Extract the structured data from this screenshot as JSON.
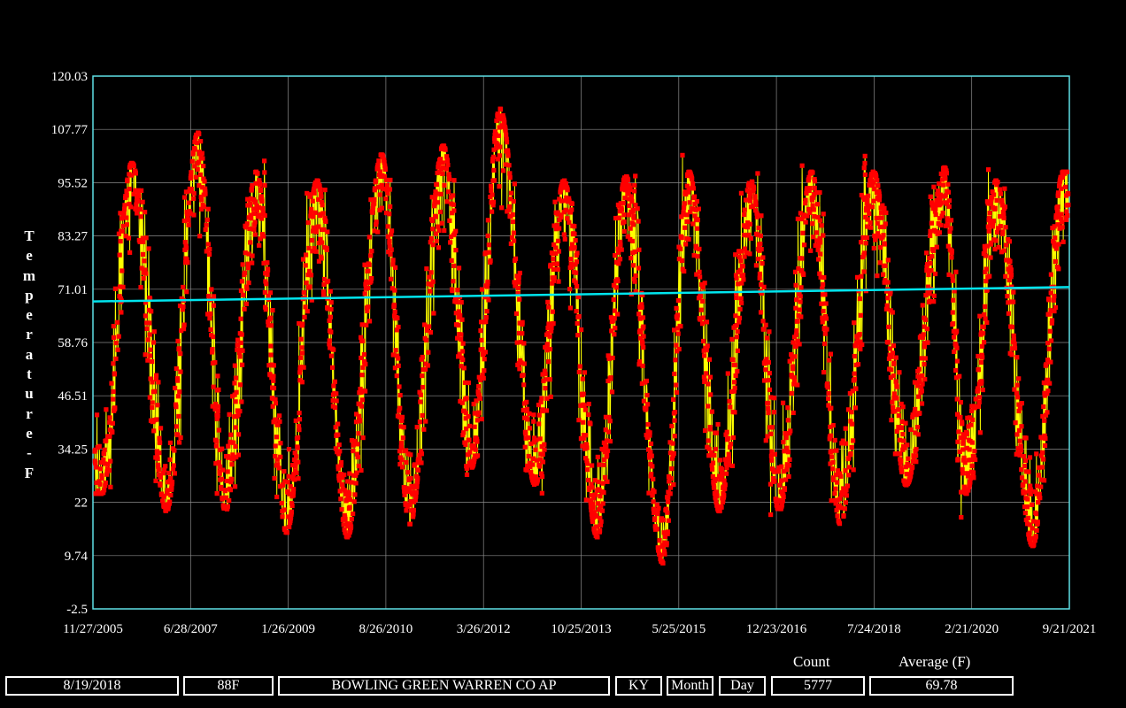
{
  "chart_data": {
    "type": "scatter",
    "ylabel": "Temperature - F",
    "y_ticks": [
      "120.03",
      "107.77",
      "95.52",
      "83.27",
      "71.01",
      "58.76",
      "46.51",
      "34.25",
      "22",
      "9.74",
      "-2.5"
    ],
    "x_ticks": [
      "11/27/2005",
      "6/28/2007",
      "1/26/2009",
      "8/26/2010",
      "3/26/2012",
      "10/25/2013",
      "5/25/2015",
      "12/23/2016",
      "7/24/2018",
      "2/21/2020",
      "9/21/2021"
    ],
    "ylim": [
      -2.5,
      120.03
    ],
    "xlim": [
      "2005-11-27",
      "2021-09-21"
    ],
    "grid": true,
    "series": [
      {
        "marker": "square",
        "color": "#ff0000",
        "connector_color": "#ffff00",
        "daily_extremes_by_season": {
          "summer_high_typical": [
            95,
            101
          ],
          "winter_low_typical": [
            20,
            30
          ],
          "record_high": 110.5,
          "record_low": 14
        },
        "yearly_peaks": [
          {
            "x": "2006-07-15",
            "y": 98
          },
          {
            "x": "2007-08-10",
            "y": 105
          },
          {
            "x": "2008-07-20",
            "y": 96
          },
          {
            "x": "2009-07-15",
            "y": 94
          },
          {
            "x": "2010-08-01",
            "y": 100
          },
          {
            "x": "2011-08-01",
            "y": 102
          },
          {
            "x": "2012-07-01",
            "y": 110.5
          },
          {
            "x": "2013-07-15",
            "y": 94
          },
          {
            "x": "2014-07-15",
            "y": 95
          },
          {
            "x": "2015-07-25",
            "y": 96
          },
          {
            "x": "2016-07-25",
            "y": 94
          },
          {
            "x": "2017-07-20",
            "y": 96
          },
          {
            "x": "2018-07-20",
            "y": 96
          },
          {
            "x": "2019-09-15",
            "y": 97
          },
          {
            "x": "2020-07-15",
            "y": 94
          },
          {
            "x": "2021-08-15",
            "y": 96
          }
        ],
        "yearly_troughs": [
          {
            "x": "2006-01-20",
            "y": 26
          },
          {
            "x": "2007-02-05",
            "y": 22
          },
          {
            "x": "2008-01-20",
            "y": 22
          },
          {
            "x": "2009-01-16",
            "y": 17
          },
          {
            "x": "2010-01-10",
            "y": 16
          },
          {
            "x": "2011-01-15",
            "y": 19
          },
          {
            "x": "2012-01-15",
            "y": 32
          },
          {
            "x": "2013-01-25",
            "y": 28
          },
          {
            "x": "2014-01-28",
            "y": 16
          },
          {
            "x": "2015-02-20",
            "y": 10
          },
          {
            "x": "2016-01-20",
            "y": 22
          },
          {
            "x": "2017-01-08",
            "y": 22
          },
          {
            "x": "2018-01-05",
            "y": 19
          },
          {
            "x": "2019-01-30",
            "y": 28
          },
          {
            "x": "2020-01-20",
            "y": 26
          },
          {
            "x": "2021-02-16",
            "y": 14
          }
        ]
      },
      {
        "type": "line",
        "role": "trend",
        "color": "#00e5ee",
        "points": [
          {
            "x": "2005-11-27",
            "y": 68.2
          },
          {
            "x": "2021-09-21",
            "y": 71.5
          }
        ]
      }
    ]
  },
  "footer": {
    "date": "8/19/2018",
    "temp": "88F",
    "station": "BOWLING GREEN WARREN CO AP",
    "state": "KY",
    "month_label": "Month",
    "day_label": "Day",
    "count_label": "Count",
    "count": "5777",
    "average_label": "Average (F)",
    "average": "69.78"
  }
}
